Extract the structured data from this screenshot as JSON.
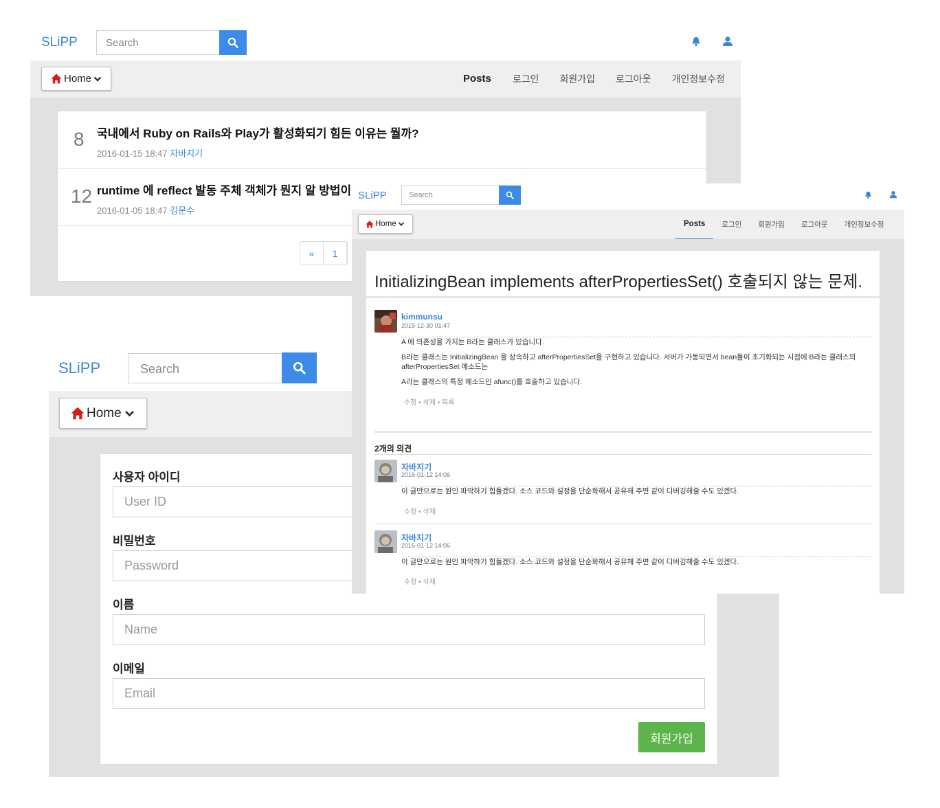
{
  "colors": {
    "brand": "#3a87d6",
    "search_button": "#3d8be8",
    "home_icon": "#d71a1a",
    "submit": "#5cb54a",
    "nav_bg": "#efefef",
    "content_bg": "#e1e1e1"
  },
  "icons": {
    "search": "search-icon",
    "bell": "bell-icon",
    "user": "user-icon",
    "home": "home-icon",
    "chevron": "chevron-down-icon"
  },
  "shared": {
    "brand": "SLiPP",
    "search_placeholder": "Search",
    "home_label": "Home",
    "nav": [
      "Posts",
      "로그인",
      "회원가입",
      "로그아웃",
      "개인정보수정"
    ]
  },
  "list_page": {
    "posts": [
      {
        "count": "8",
        "title": "국내에서 Ruby on Rails와 Play가 활성화되기 힘든 이유는 뭘까?",
        "date": "2016-01-15 18:47",
        "author": "자바지기"
      },
      {
        "count": "12",
        "title": "runtime 에 reflect 발동 주체 객체가 뭔지 알 방법이 있을까요?",
        "date": "2016-01-05 18:47",
        "author": "김문수"
      }
    ],
    "pagination": [
      "«",
      "1"
    ]
  },
  "article_page": {
    "title": "InitializingBean implements afterPropertiesSet() 호출되지 않는 문제.",
    "author": "kimmunsu",
    "date": "2015-12-30 01:47",
    "paragraphs": [
      "A 에 의존성을 가지는 B라는 클래스가 있습니다.",
      "B라는 클래스는 InitializingBean 을 상속하고 afterPropertiesSet을 구현하고 있습니다. 서버가 가동되면서 bean들이 초기화되는 시점에 B라는 클래스의 afterPropertiesSet 메소드는",
      "A라는 클래스의 특정 메소드인 afunc()를 호출하고 있습니다."
    ],
    "actions": "수정 • 삭제 • 목록",
    "comments_heading": "2개의 의견",
    "comments": [
      {
        "author": "자바지기",
        "date": "2016-01-12 14:06",
        "text": "이 글만으로는 원인 파악하기 힘들겠다. 소스 코드와 설정을 단순화해서 공유해 주면 같이 디버깅해줄 수도 있겠다.",
        "actions": "수정 • 삭제"
      },
      {
        "author": "자바지기",
        "date": "2016-01-12 14:06",
        "text": "이 글만으로는 원인 파악하기 힘들겠다. 소스 코드와 설정을 단순화해서 공유해 주면 같이 디버깅해줄 수도 있겠다.",
        "actions": "수정 • 삭제"
      }
    ]
  },
  "signup_page": {
    "fields": [
      {
        "label": "사용자 아이디",
        "placeholder": "User ID"
      },
      {
        "label": "비밀번호",
        "placeholder": "Password"
      },
      {
        "label": "이름",
        "placeholder": "Name"
      },
      {
        "label": "이메일",
        "placeholder": "Email"
      }
    ],
    "submit_label": "회원가입"
  }
}
